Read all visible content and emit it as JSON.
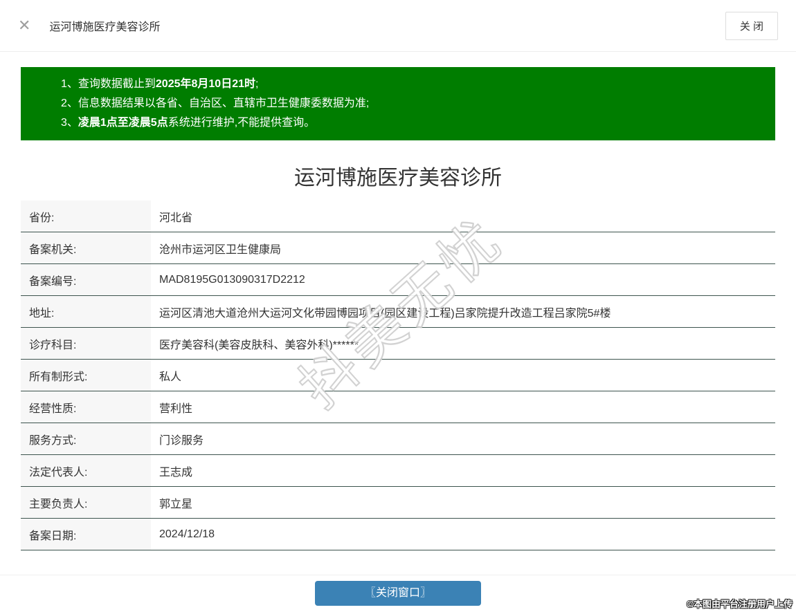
{
  "header": {
    "x_icon": "✕",
    "title": "运河博施医疗美容诊所",
    "close_button_label": "关 闭"
  },
  "notice": {
    "background_color": "#007d00",
    "lines": [
      {
        "pre": "1、查询数据截止到",
        "bold": "2025年8月10日21时",
        "post": ";"
      },
      {
        "pre": "2、信息数据结果以各省、自治区、直辖市卫生健康委数据为准;",
        "bold": "",
        "post": ""
      },
      {
        "pre": "3、",
        "bold": "凌晨1点至凌晨5点",
        "post": "系统进行维护,不能提供查询。"
      }
    ]
  },
  "main": {
    "title": "运河博施医疗美容诊所"
  },
  "table": {
    "rows": [
      {
        "label": "省份:",
        "value": "河北省"
      },
      {
        "label": "备案机关:",
        "value": "沧州市运河区卫生健康局"
      },
      {
        "label": "备案编号:",
        "value": "MAD8195G013090317D2212"
      },
      {
        "label": "地址:",
        "value": "运河区清池大道沧州大运河文化带园博园项目(园区建设工程)吕家院提升改造工程吕家院5#楼"
      },
      {
        "label": "诊疗科目:",
        "value": "医疗美容科(美容皮肤科、美容外科)******"
      },
      {
        "label": "所有制形式:",
        "value": "私人"
      },
      {
        "label": "经营性质:",
        "value": "营利性"
      },
      {
        "label": "服务方式:",
        "value": "门诊服务"
      },
      {
        "label": "法定代表人:",
        "value": "王志成"
      },
      {
        "label": "主要负责人:",
        "value": "郭立星"
      },
      {
        "label": "备案日期:",
        "value": "2024/12/18"
      }
    ]
  },
  "footer": {
    "close_window_button": "〖关闭窗口〗",
    "button_color": "#3b82b5"
  },
  "watermark": {
    "diagonal_text": "抖美无忧",
    "credit_text": "©本图由平台注册用户上传"
  }
}
